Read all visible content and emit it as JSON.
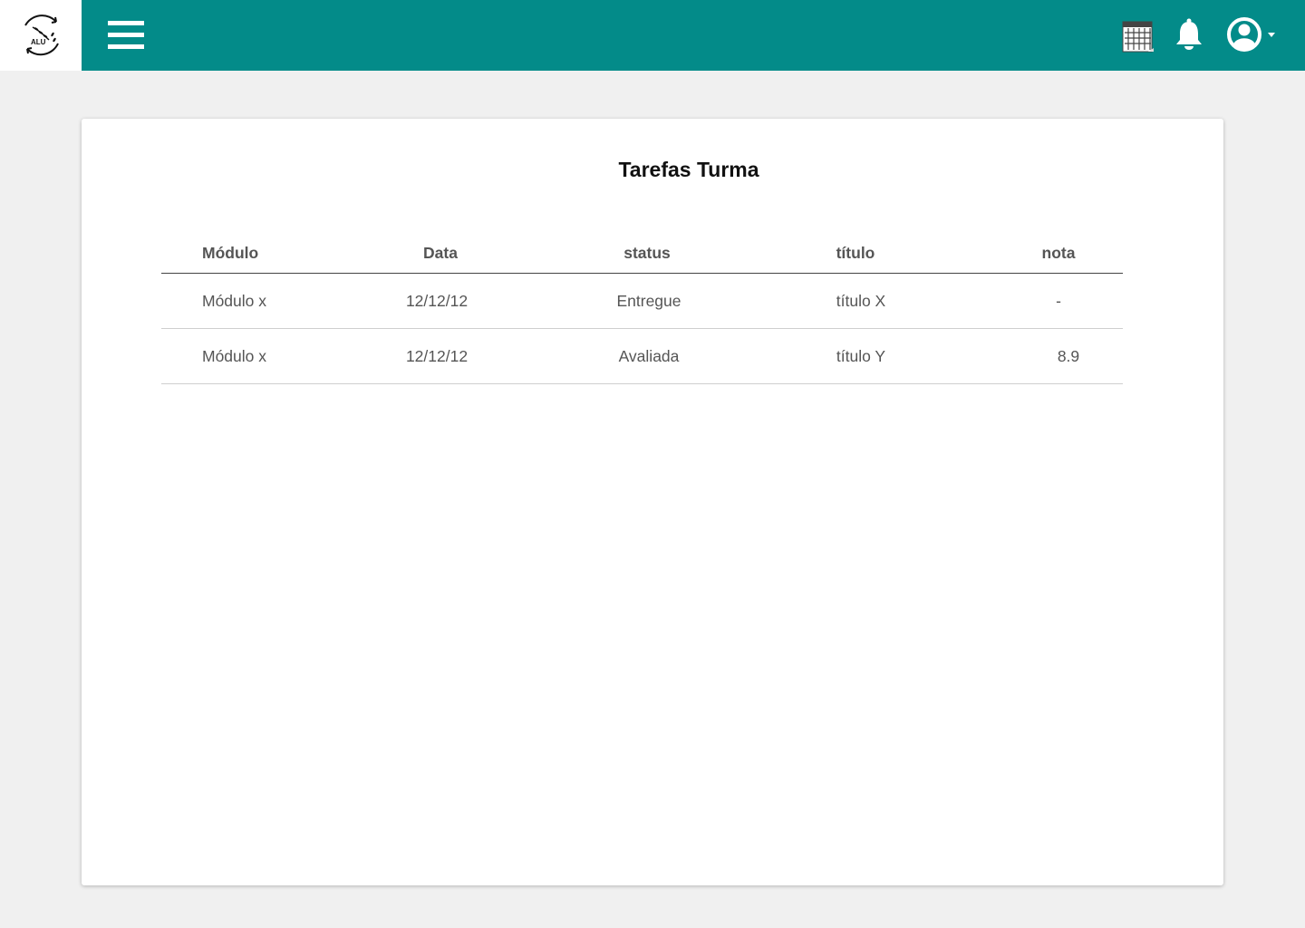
{
  "header": {
    "logo_text": "ALU",
    "brand_color": "#038b89",
    "icons": [
      "menu-icon",
      "calendar-icon",
      "bell-icon",
      "user-icon",
      "caret-down-icon"
    ]
  },
  "page": {
    "title": "Tarefas Turma"
  },
  "table": {
    "columns": [
      "Módulo",
      "Data",
      "status",
      "título",
      "nota"
    ],
    "rows": [
      {
        "modulo": "Módulo x",
        "data": "12/12/12",
        "status": "Entregue",
        "titulo": "título X",
        "nota": "-"
      },
      {
        "modulo": "Módulo x",
        "data": "12/12/12",
        "status": "Avaliada",
        "titulo": "título Y",
        "nota": "8.9"
      }
    ]
  }
}
